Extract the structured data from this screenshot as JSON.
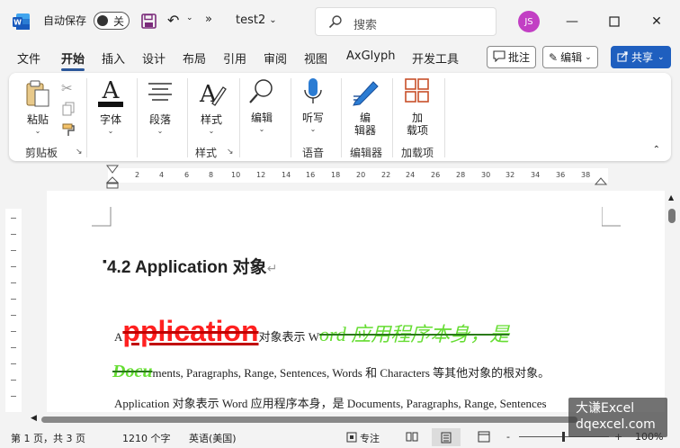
{
  "titlebar": {
    "autosave_label": "自动保存",
    "toggle_state": "关",
    "more": "»",
    "doc_title": "test2",
    "search_placeholder": "搜索",
    "avatar_initials": "JS"
  },
  "tabs": [
    "文件",
    "开始",
    "插入",
    "设计",
    "布局",
    "引用",
    "审阅",
    "视图",
    "AxGlyph",
    "开发工具"
  ],
  "active_tab": "开始",
  "ribbon_actions": {
    "comments": "批注",
    "editing": "编辑",
    "share": "共享"
  },
  "ribbon": {
    "paste": "粘贴",
    "font": "字体",
    "paragraph": "段落",
    "styles": "样式",
    "edit": "编辑",
    "dictate": "听写",
    "editor_l1": "编",
    "editor_l2": "辑器",
    "addins_l1": "加",
    "addins_l2": "载项",
    "groups": {
      "clipboard": "剪贴板",
      "styles": "样式",
      "voice": "语音",
      "editor": "编辑器",
      "addins": "加载项"
    }
  },
  "ruler_ticks": [
    "2",
    "4",
    "6",
    "8",
    "10",
    "12",
    "14",
    "16",
    "18",
    "20",
    "22",
    "24",
    "26",
    "28",
    "30",
    "32",
    "34",
    "36",
    "38"
  ],
  "document": {
    "heading": "4.2 Application  对象",
    "line1_a": "A",
    "line1_big": "pplication",
    "line1_mid": "对象表示 W",
    "line1_green": "ord 应用程序本身，是",
    "line2_green": "Docu",
    "line2_rest": "ments, Paragraphs, Range, Sentences, Words 和 Characters 等其他对象的根对象。",
    "line3": "Application 对象表示 Word 应用程序本身，是 Documents, Paragraphs, Range, Sentences"
  },
  "status": {
    "page": "第 1 页，共 3 页",
    "words": "1210 个字",
    "language": "英语(美国)",
    "focus": "专注",
    "zoom_minus": "-",
    "zoom_plus": "+",
    "zoom": "100%"
  },
  "watermark": {
    "line1": "大谦Excel",
    "line2": "dqexcel.com"
  },
  "colors": {
    "accent": "#2b579a",
    "share": "#1f5fbf",
    "avatar": "#c23fc4",
    "red_text": "#ff2020",
    "green_text": "#66dd33"
  }
}
